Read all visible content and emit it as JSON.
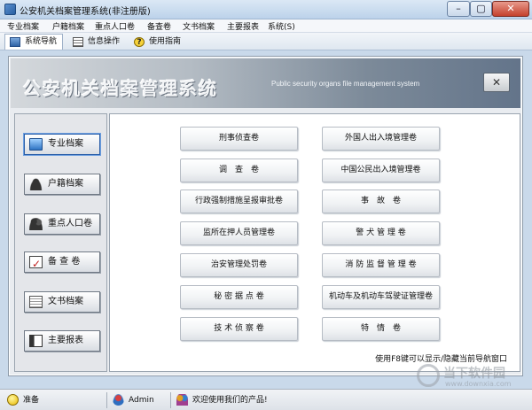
{
  "window": {
    "title": "公安机关档案管理系统(非注册版)",
    "minimize_glyph": "–",
    "maximize_glyph": "▢",
    "close_glyph": "✕"
  },
  "menu": [
    "专业档案",
    "户籍档案",
    "重点人口卷",
    "备查卷",
    "文书档案",
    "主要报表",
    "系统(S)"
  ],
  "tabs": [
    {
      "label": "系统导航",
      "icon": "monitor-icon",
      "active": true
    },
    {
      "label": "信息操作",
      "icon": "document-icon",
      "active": false
    },
    {
      "label": "使用指南",
      "icon": "help-icon",
      "active": false
    }
  ],
  "banner": {
    "title": "公安机关档案管理系统",
    "subtitle": "Public security organs file management system",
    "close_glyph": "✕"
  },
  "sidebar": {
    "items": [
      {
        "label": "专业档案",
        "icon": "monitor-icon",
        "active": true
      },
      {
        "label": "户籍档案",
        "icon": "person-icon",
        "active": false
      },
      {
        "label": "重点人口卷",
        "icon": "people-icon",
        "active": false
      },
      {
        "label": "备 查 卷",
        "icon": "checklist-icon",
        "active": false
      },
      {
        "label": "文书档案",
        "icon": "document-icon",
        "active": false
      },
      {
        "label": "主要报表",
        "icon": "report-book-icon",
        "active": false
      }
    ]
  },
  "documents": {
    "left": [
      "刑事侦查卷",
      "调　查　卷",
      "行政强制措施呈报审批卷",
      "监所在押人员管理卷",
      "治安管理处罚卷",
      "秘 密 据 点 卷",
      "技 术 侦 察 卷"
    ],
    "right": [
      "外国人出入境管理卷",
      "中国公民出入境管理卷",
      "事　故　卷",
      "警 犬 管 理 卷",
      "消 防 监 督 管 理 卷",
      "机动车及机动车驾驶证管理卷",
      "特　情　卷"
    ]
  },
  "hint": "使用F8键可以显示/隐藏当前导航窗口",
  "status": {
    "state": "准备",
    "user": "Admin",
    "welcome": "欢迎使用我们的产品!"
  },
  "watermark": {
    "name": "当下软件园",
    "url": "www.downxia.com"
  }
}
